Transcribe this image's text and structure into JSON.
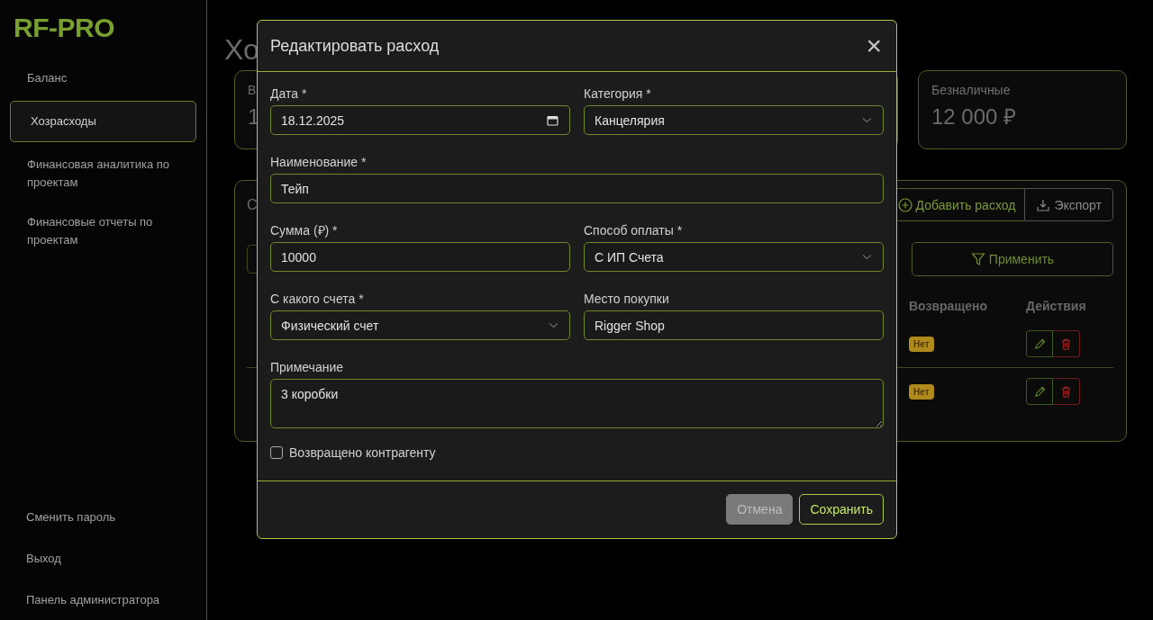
{
  "sidebar": {
    "logo": "RF-PRO",
    "items": [
      {
        "label": "Баланс",
        "selected": false
      },
      {
        "label": "Хозрасходы",
        "selected": true
      },
      {
        "label": "Финансовая аналитика по проектам",
        "selected": false
      },
      {
        "label": "Финансовые отчеты по проектам",
        "selected": false
      }
    ],
    "bottom_items": [
      "Сменить пароль",
      "Выход",
      "Панель администратора"
    ]
  },
  "page": {
    "title": "Хо",
    "cards": [
      {
        "label": "В",
        "value": "1"
      },
      {
        "label": "Безналичные",
        "value": "12 000 ₽"
      }
    ],
    "expenses": {
      "title": "С",
      "add_button": "Добавить расход",
      "export_button": "Экспорт",
      "apply_button": "Применить",
      "columns": [
        "Возвращено",
        "Действия"
      ],
      "rows": [
        {
          "returned": "Нет"
        },
        {
          "returned": "Нет"
        }
      ]
    }
  },
  "modal": {
    "title": "Редактировать расход",
    "close": "×",
    "rows": [
      [
        {
          "kind": "date",
          "label": "Дата *",
          "value": "18.12.2025"
        },
        {
          "kind": "select",
          "label": "Категория *",
          "value": "Канцелярия"
        }
      ],
      [
        {
          "kind": "text",
          "label": "Наименование *",
          "value": "Тейп"
        }
      ],
      [
        {
          "kind": "text",
          "label": "Сумма (₽) *",
          "value": "10000"
        },
        {
          "kind": "select",
          "label": "Способ оплаты *",
          "value": "С ИП Счета"
        }
      ],
      [
        {
          "kind": "select",
          "label": "С какого счета *",
          "value": "Физический счет"
        },
        {
          "kind": "text",
          "label": "Место покупки",
          "value": "Rigger Shop"
        }
      ],
      [
        {
          "kind": "textarea",
          "label": "Примечание",
          "value": "3 коробки"
        }
      ]
    ],
    "checkbox": {
      "label": "Возвращено контрагенту",
      "checked": false
    },
    "buttons": [
      {
        "kind": "cancel",
        "label": "Отмена"
      },
      {
        "kind": "save",
        "label": "Сохранить"
      }
    ]
  }
}
